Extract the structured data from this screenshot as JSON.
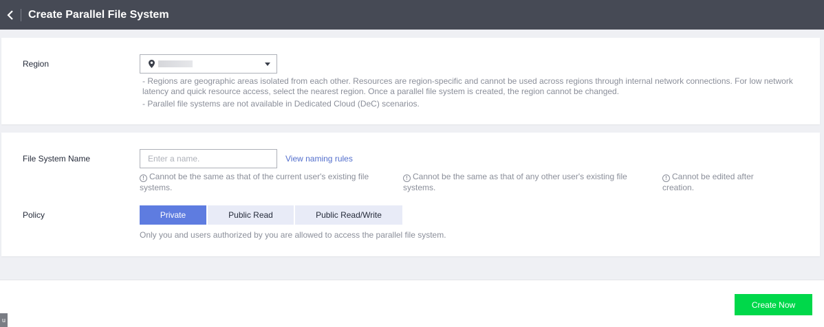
{
  "header": {
    "title": "Create Parallel File System",
    "back_icon": "chevron-left-icon"
  },
  "region": {
    "label": "Region",
    "value": "",
    "icon": "location-pin-icon",
    "help_1": "- Regions are geographic areas isolated from each other. Resources are region-specific and cannot be used across regions through internal network connections. For low network latency and quick resource access, select the nearest region. Once a parallel file system is created, the region cannot be changed.",
    "help_2": "- Parallel file systems are not available in Dedicated Cloud (DeC) scenarios."
  },
  "file_system_name": {
    "label": "File System Name",
    "placeholder": "Enter a name.",
    "value": "",
    "naming_rules_link": "View naming rules",
    "tips": [
      "Cannot be the same as that of the current user's existing file systems.",
      "Cannot be the same as that of any other user's existing file systems.",
      "Cannot be edited after creation."
    ]
  },
  "policy": {
    "label": "Policy",
    "options": [
      "Private",
      "Public Read",
      "Public Read/Write"
    ],
    "selected": "Private",
    "description": "Only you and users authorized by you are allowed to access the parallel file system."
  },
  "footer": {
    "create_label": "Create Now"
  },
  "colors": {
    "topbar": "#464a55",
    "accent": "#5e7ce0",
    "create_button": "#00d84a",
    "link": "#526ecc"
  }
}
